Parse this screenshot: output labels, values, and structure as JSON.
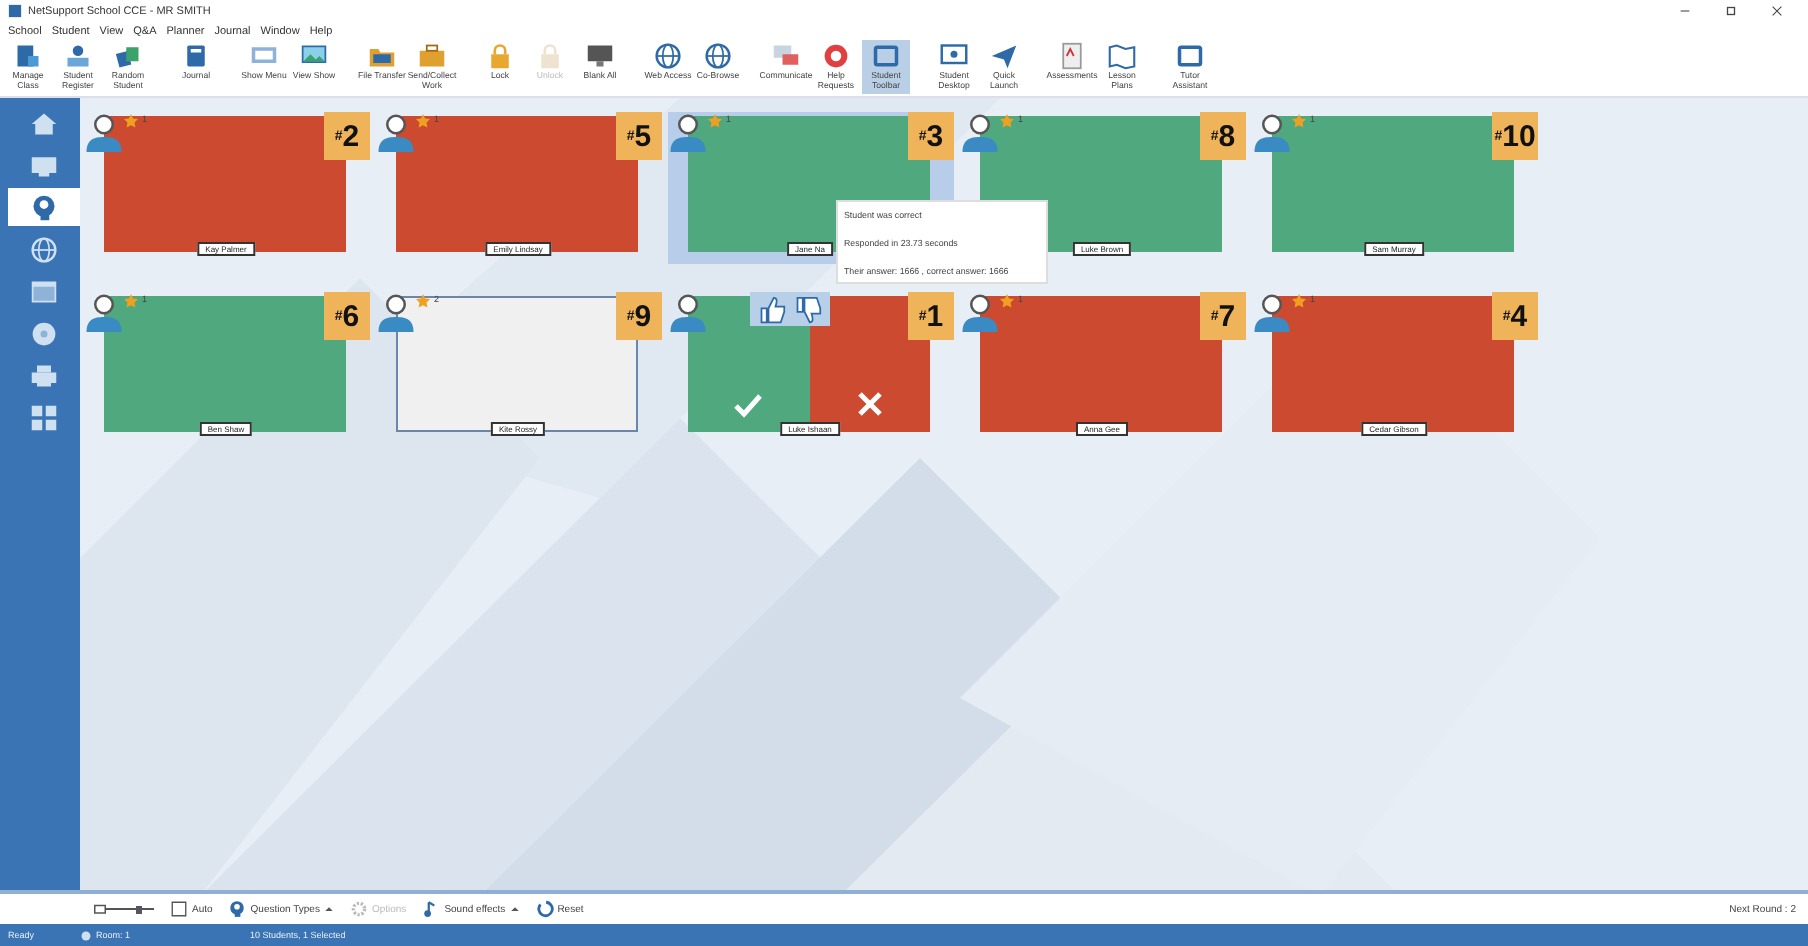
{
  "window": {
    "title": "NetSupport School CCE - MR SMITH"
  },
  "menu": [
    "School",
    "Student",
    "View",
    "Q&A",
    "Planner",
    "Journal",
    "Window",
    "Help"
  ],
  "toolbar": [
    [
      {
        "label": "Manage Class",
        "disabled": false,
        "selected": false
      },
      {
        "label": "Student Register",
        "disabled": false,
        "selected": false
      },
      {
        "label": "Random Student",
        "disabled": false,
        "selected": false
      }
    ],
    [
      {
        "label": "Journal",
        "disabled": false,
        "selected": false
      }
    ],
    [
      {
        "label": "Show Menu",
        "disabled": false,
        "selected": false
      },
      {
        "label": "View Show",
        "disabled": false,
        "selected": false
      }
    ],
    [
      {
        "label": "File Transfer",
        "disabled": false,
        "selected": false
      },
      {
        "label": "Send/Collect Work",
        "disabled": false,
        "selected": false
      }
    ],
    [
      {
        "label": "Lock",
        "disabled": false,
        "selected": false
      },
      {
        "label": "Unlock",
        "disabled": true,
        "selected": false
      },
      {
        "label": "Blank All",
        "disabled": false,
        "selected": false
      }
    ],
    [
      {
        "label": "Web Access",
        "disabled": false,
        "selected": false
      },
      {
        "label": "Co-Browse",
        "disabled": false,
        "selected": false
      }
    ],
    [
      {
        "label": "Communicate",
        "disabled": false,
        "selected": false
      },
      {
        "label": "Help Requests",
        "disabled": false,
        "selected": false
      },
      {
        "label": "Student Toolbar",
        "disabled": false,
        "selected": true
      }
    ],
    [
      {
        "label": "Student Desktop",
        "disabled": false,
        "selected": false
      },
      {
        "label": "Quick Launch",
        "disabled": false,
        "selected": false
      }
    ],
    [
      {
        "label": "Assessments",
        "disabled": false,
        "selected": false
      },
      {
        "label": "Lesson Plans",
        "disabled": false,
        "selected": false
      }
    ],
    [
      {
        "label": "Tutor Assistant",
        "disabled": false,
        "selected": false
      }
    ]
  ],
  "sidebar": [
    {
      "selected": false
    },
    {
      "selected": false
    },
    {
      "selected": true
    },
    {
      "selected": false
    },
    {
      "selected": false
    },
    {
      "selected": false
    },
    {
      "selected": false
    },
    {
      "selected": false
    }
  ],
  "students": [
    [
      {
        "name": "Kay Palmer",
        "star_count": "1",
        "rank": "$^{#}$2",
        "kind": "incorrect",
        "selected": false
      },
      {
        "name": "Emily Lindsay",
        "star_count": "1",
        "rank": "$^{#}$5",
        "kind": "incorrect",
        "selected": false
      },
      {
        "name": "Jane Na",
        "star_count": "1",
        "rank": "$^{#}$3",
        "kind": "correct",
        "selected": true
      },
      {
        "name": "Luke Brown",
        "star_count": "1",
        "rank": "$^{#}$8",
        "kind": "correct",
        "selected": false
      },
      {
        "name": "Sam Murray",
        "star_count": "1",
        "rank": "$^{#}$10",
        "kind": "correct",
        "selected": false
      }
    ],
    [
      {
        "name": "Ben Shaw",
        "star_count": "1",
        "rank": "$^{#}$6",
        "kind": "correct",
        "selected": false
      },
      {
        "name": "Kite Rossy",
        "star_count": "2",
        "rank": "$^{#}$9",
        "kind": "pending",
        "selected": false
      },
      {
        "name": "Luke Ishaan",
        "rank": "$^{#}$1",
        "kind": "marking",
        "selected": false
      },
      {
        "name": "Anna Gee",
        "star_count": "1",
        "rank": "$^{#}$7",
        "kind": "incorrect",
        "selected": false
      },
      {
        "name": "Cedar Gibson",
        "star_count": "1",
        "rank": "$^{#}$4",
        "kind": "incorrect",
        "selected": false
      }
    ]
  ],
  "tooltip": [
    "Student was correct",
    "Responded in 23.73 seconds",
    "Their answer: 1666 , correct answer: 1666"
  ],
  "bottom_toolbar": {
    "items": [
      {
        "kind": "slider",
        "level": 0.7
      },
      {
        "kind": "button",
        "label": "Auto",
        "disabled": false
      },
      {
        "kind": "button",
        "label": "Question Types",
        "caret": true,
        "disabled": false
      },
      {
        "kind": "button",
        "label": "Options",
        "disabled": true
      },
      {
        "kind": "button",
        "label": "Sound effects",
        "caret": true,
        "disabled": false
      },
      {
        "kind": "button",
        "label": "Reset",
        "disabled": false
      }
    ],
    "next_round": "Next Round : 2"
  },
  "status_bar": {
    "state": "Ready",
    "room": "Room: 1",
    "students": "10 Students, 1 Selected"
  }
}
